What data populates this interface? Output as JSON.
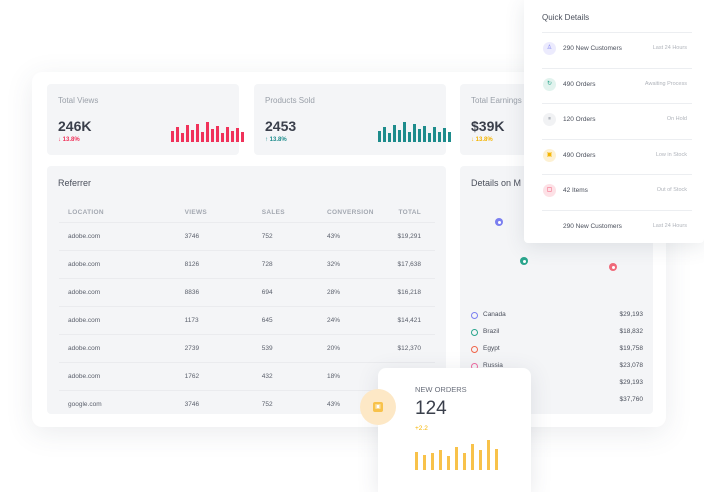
{
  "stats": [
    {
      "label": "Total Views",
      "value": "246K",
      "delta": "13.8%",
      "direction": "down",
      "color": "#f0325a"
    },
    {
      "label": "Products Sold",
      "value": "2453",
      "delta": "13.8%",
      "direction": "up",
      "color": "#1e8c8c"
    },
    {
      "label": "Total Earnings",
      "value": "$39K",
      "delta": "13.8%",
      "direction": "down",
      "color": "#f5b400"
    }
  ],
  "referrer": {
    "title": "Referrer",
    "columns": [
      "LOCATION",
      "VIEWS",
      "SALES",
      "CONVERSION",
      "TOTAL"
    ],
    "rows": [
      [
        "adobe.com",
        "3746",
        "752",
        "43%",
        "$19,291"
      ],
      [
        "adobe.com",
        "8126",
        "728",
        "32%",
        "$17,638"
      ],
      [
        "adobe.com",
        "8836",
        "694",
        "28%",
        "$16,218"
      ],
      [
        "adobe.com",
        "1173",
        "645",
        "24%",
        "$14,421"
      ],
      [
        "adobe.com",
        "2739",
        "539",
        "20%",
        "$12,370"
      ],
      [
        "adobe.com",
        "1762",
        "432",
        "18%",
        ""
      ],
      [
        "google.com",
        "3746",
        "752",
        "43%",
        ""
      ]
    ]
  },
  "map": {
    "title": "Details on M",
    "countries": [
      {
        "name": "Canada",
        "value": "$29,193",
        "color": "#7b7ff0"
      },
      {
        "name": "Brazil",
        "value": "$18,832",
        "color": "#2aa58d"
      },
      {
        "name": "Egypt",
        "value": "$19,758",
        "color": "#f0654a"
      },
      {
        "name": "Russia",
        "value": "$23,078",
        "color": "#f06aa0"
      },
      {
        "name": "",
        "value": "$29,193",
        "color": "#f5b400"
      },
      {
        "name": "",
        "value": "$37,760",
        "color": "#7b7ff0"
      }
    ]
  },
  "quick_details": {
    "title": "Quick Details",
    "items": [
      {
        "text": "290 New Customers",
        "status": "Last 24 Hours",
        "icon": "user-icon",
        "color": "#7b7ff0",
        "bg": "#ecebfd"
      },
      {
        "text": "490 Orders",
        "status": "Awaiting Process",
        "icon": "refresh-icon",
        "color": "#2aa58d",
        "bg": "#e2f3ee"
      },
      {
        "text": "120 Orders",
        "status": "On Hold",
        "icon": "pause-icon",
        "color": "#9aa0a9",
        "bg": "#f1f2f4"
      },
      {
        "text": "490 Orders",
        "status": "Low in Stock",
        "icon": "box-icon",
        "color": "#f5b400",
        "bg": "#fdf1d3"
      },
      {
        "text": "42 Items",
        "status": "Out of Stock",
        "icon": "cart-icon",
        "color": "#f0325a",
        "bg": "#fde1e6"
      },
      {
        "text": "290 New Customers",
        "status": "Last 24 Hours",
        "icon": "",
        "color": "",
        "bg": ""
      }
    ]
  },
  "new_orders": {
    "label": "NEW ORDERS",
    "value": "124",
    "change": "+2.2",
    "icon": "bag-icon",
    "bar_color": "#f8c24a",
    "bars": [
      0.6,
      0.5,
      0.55,
      0.65,
      0.45,
      0.75,
      0.55,
      0.85,
      0.65,
      1.0,
      0.7
    ]
  },
  "sparklines": {
    "views": [
      0.55,
      0.75,
      0.45,
      0.85,
      0.6,
      0.9,
      0.5,
      1.0,
      0.65,
      0.8,
      0.45,
      0.75,
      0.55,
      0.7,
      0.5
    ],
    "products": [
      0.55,
      0.75,
      0.45,
      0.85,
      0.6,
      1.0,
      0.5,
      0.9,
      0.65,
      0.8,
      0.45,
      0.75,
      0.5,
      0.7,
      0.5
    ]
  }
}
